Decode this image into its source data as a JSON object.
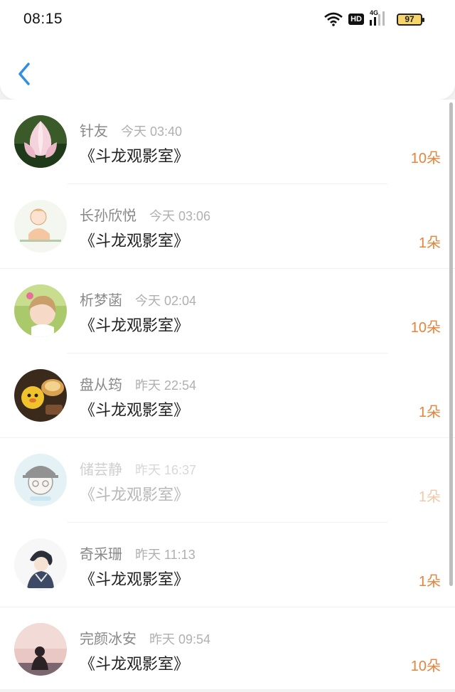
{
  "status_bar": {
    "time": "08:15",
    "hd_label": "HD",
    "network_label": "4G",
    "battery": "97"
  },
  "nav": {
    "back_icon": "chevron-left-icon",
    "accent": "#2f8fe0"
  },
  "gift_color": "#e8833a",
  "items": [
    {
      "name": "针友",
      "time": "今天 03:40",
      "title": "《斗龙观影室》",
      "gift": "10朵"
    },
    {
      "name": "长孙欣悦",
      "time": "今天 03:06",
      "title": "《斗龙观影室》",
      "gift": "1朵"
    },
    {
      "name": "析梦菡",
      "time": "今天 02:04",
      "title": "《斗龙观影室》",
      "gift": "10朵"
    },
    {
      "name": "盘从筠",
      "time": "昨天 22:54",
      "title": "《斗龙观影室》",
      "gift": "1朵"
    },
    {
      "name": "储芸静",
      "time": "昨天 16:37",
      "title": "《斗龙观影室》",
      "gift": "1朵"
    },
    {
      "name": "奇采珊",
      "time": "昨天 11:13",
      "title": "《斗龙观影室》",
      "gift": "1朵"
    },
    {
      "name": "完颜冰安",
      "time": "昨天 09:54",
      "title": "《斗龙观影室》",
      "gift": "10朵"
    }
  ]
}
